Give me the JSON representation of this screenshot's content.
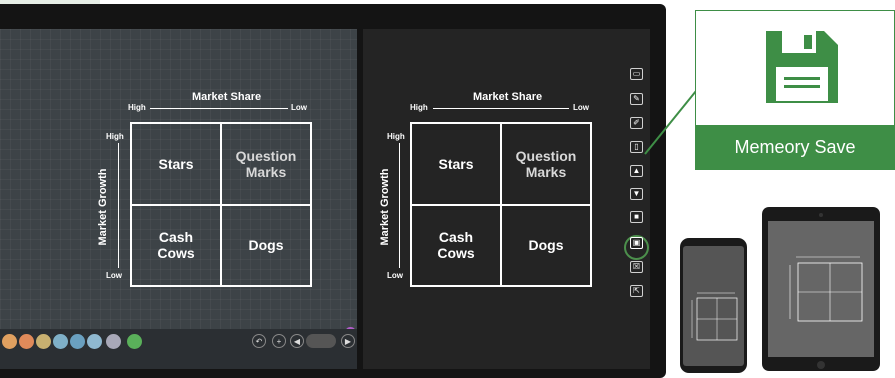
{
  "matrix": {
    "market_share": "Market Share",
    "high": "High",
    "low": "Low",
    "market_growth": "Market Growth",
    "stars": "Stars",
    "question_marks": "Question Marks",
    "cash_cows": "Cash Cows",
    "dogs": "Dogs"
  },
  "callout": {
    "label": "Memeory Save"
  },
  "toolbar": {
    "icons": [
      "screen-icon",
      "pen-icon",
      "eraser-icon",
      "page-icon",
      "upload-icon",
      "download-icon",
      "lock-icon",
      "save-icon",
      "export-icon",
      "exit-icon"
    ]
  },
  "colors": {
    "accent": "#3e8e46",
    "board": "#3d4347",
    "bezel": "#141414"
  }
}
